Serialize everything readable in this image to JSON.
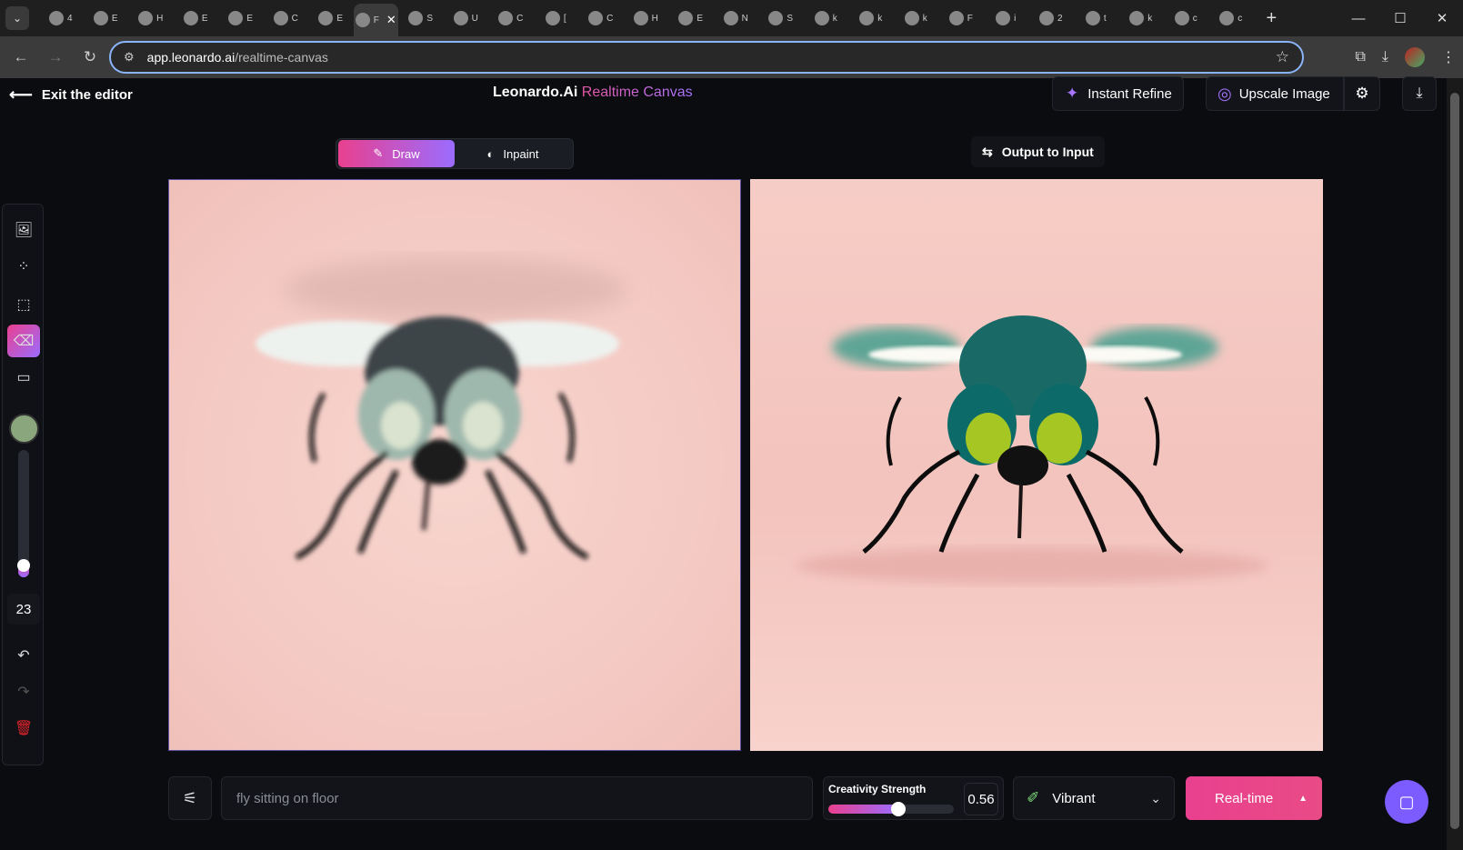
{
  "browser": {
    "tabs": [
      {
        "icon": "search-icon",
        "title": "4"
      },
      {
        "icon": "circle-icon",
        "title": "E"
      },
      {
        "icon": "app-icon",
        "title": "H"
      },
      {
        "icon": "puzzle-icon",
        "title": "E"
      },
      {
        "icon": "gear-icon",
        "title": "E"
      },
      {
        "icon": "translate-icon",
        "title": "C"
      },
      {
        "icon": "sheets-icon",
        "title": "E"
      },
      {
        "icon": "leonardo-icon",
        "title": "F",
        "active": true
      },
      {
        "icon": "circle-icon",
        "title": "S"
      },
      {
        "icon": "hat-icon",
        "title": "U"
      },
      {
        "icon": "game-icon",
        "title": "C"
      },
      {
        "icon": "diamond-icon",
        "title": "["
      },
      {
        "icon": "circle-icon",
        "title": "C"
      },
      {
        "icon": "smile-icon",
        "title": "H"
      },
      {
        "icon": "python-icon",
        "title": "E"
      },
      {
        "icon": "github-icon",
        "title": "N"
      },
      {
        "icon": "dots-icon",
        "title": "S"
      },
      {
        "icon": "google-icon",
        "title": "k"
      },
      {
        "icon": "google-icon",
        "title": "k"
      },
      {
        "icon": "google-icon",
        "title": "k"
      },
      {
        "icon": "sh-icon",
        "title": "F"
      },
      {
        "icon": "circle-icon",
        "title": "i"
      },
      {
        "icon": "is-icon",
        "title": "2"
      },
      {
        "icon": "python-icon",
        "title": "t"
      },
      {
        "icon": "google-icon",
        "title": "k"
      },
      {
        "icon": "google-icon",
        "title": "c"
      },
      {
        "icon": "google-icon",
        "title": "c"
      }
    ],
    "url_host": "app.leonardo.ai",
    "url_path": "/realtime-canvas"
  },
  "app": {
    "exit_label": "Exit the editor",
    "brand": "Leonardo.Ai",
    "brand_accent": "Realtime Canvas",
    "instant_refine": "Instant Refine",
    "upscale_image": "Upscale Image",
    "mode_draw": "Draw",
    "mode_inpaint": "Inpaint",
    "output_to_input": "Output to Input",
    "brush_size": "23",
    "brush_color": "#8aa67d",
    "prompt_placeholder": "fly sitting on floor",
    "creativity_label": "Creativity Strength",
    "creativity_value": "0.56",
    "creativity_fraction": 0.56,
    "style": "Vibrant",
    "realtime_label": "Real-time"
  },
  "colors": {
    "accent_pink": "#e9408f",
    "accent_purple": "#9b6cff",
    "background": "#0b0c10"
  }
}
